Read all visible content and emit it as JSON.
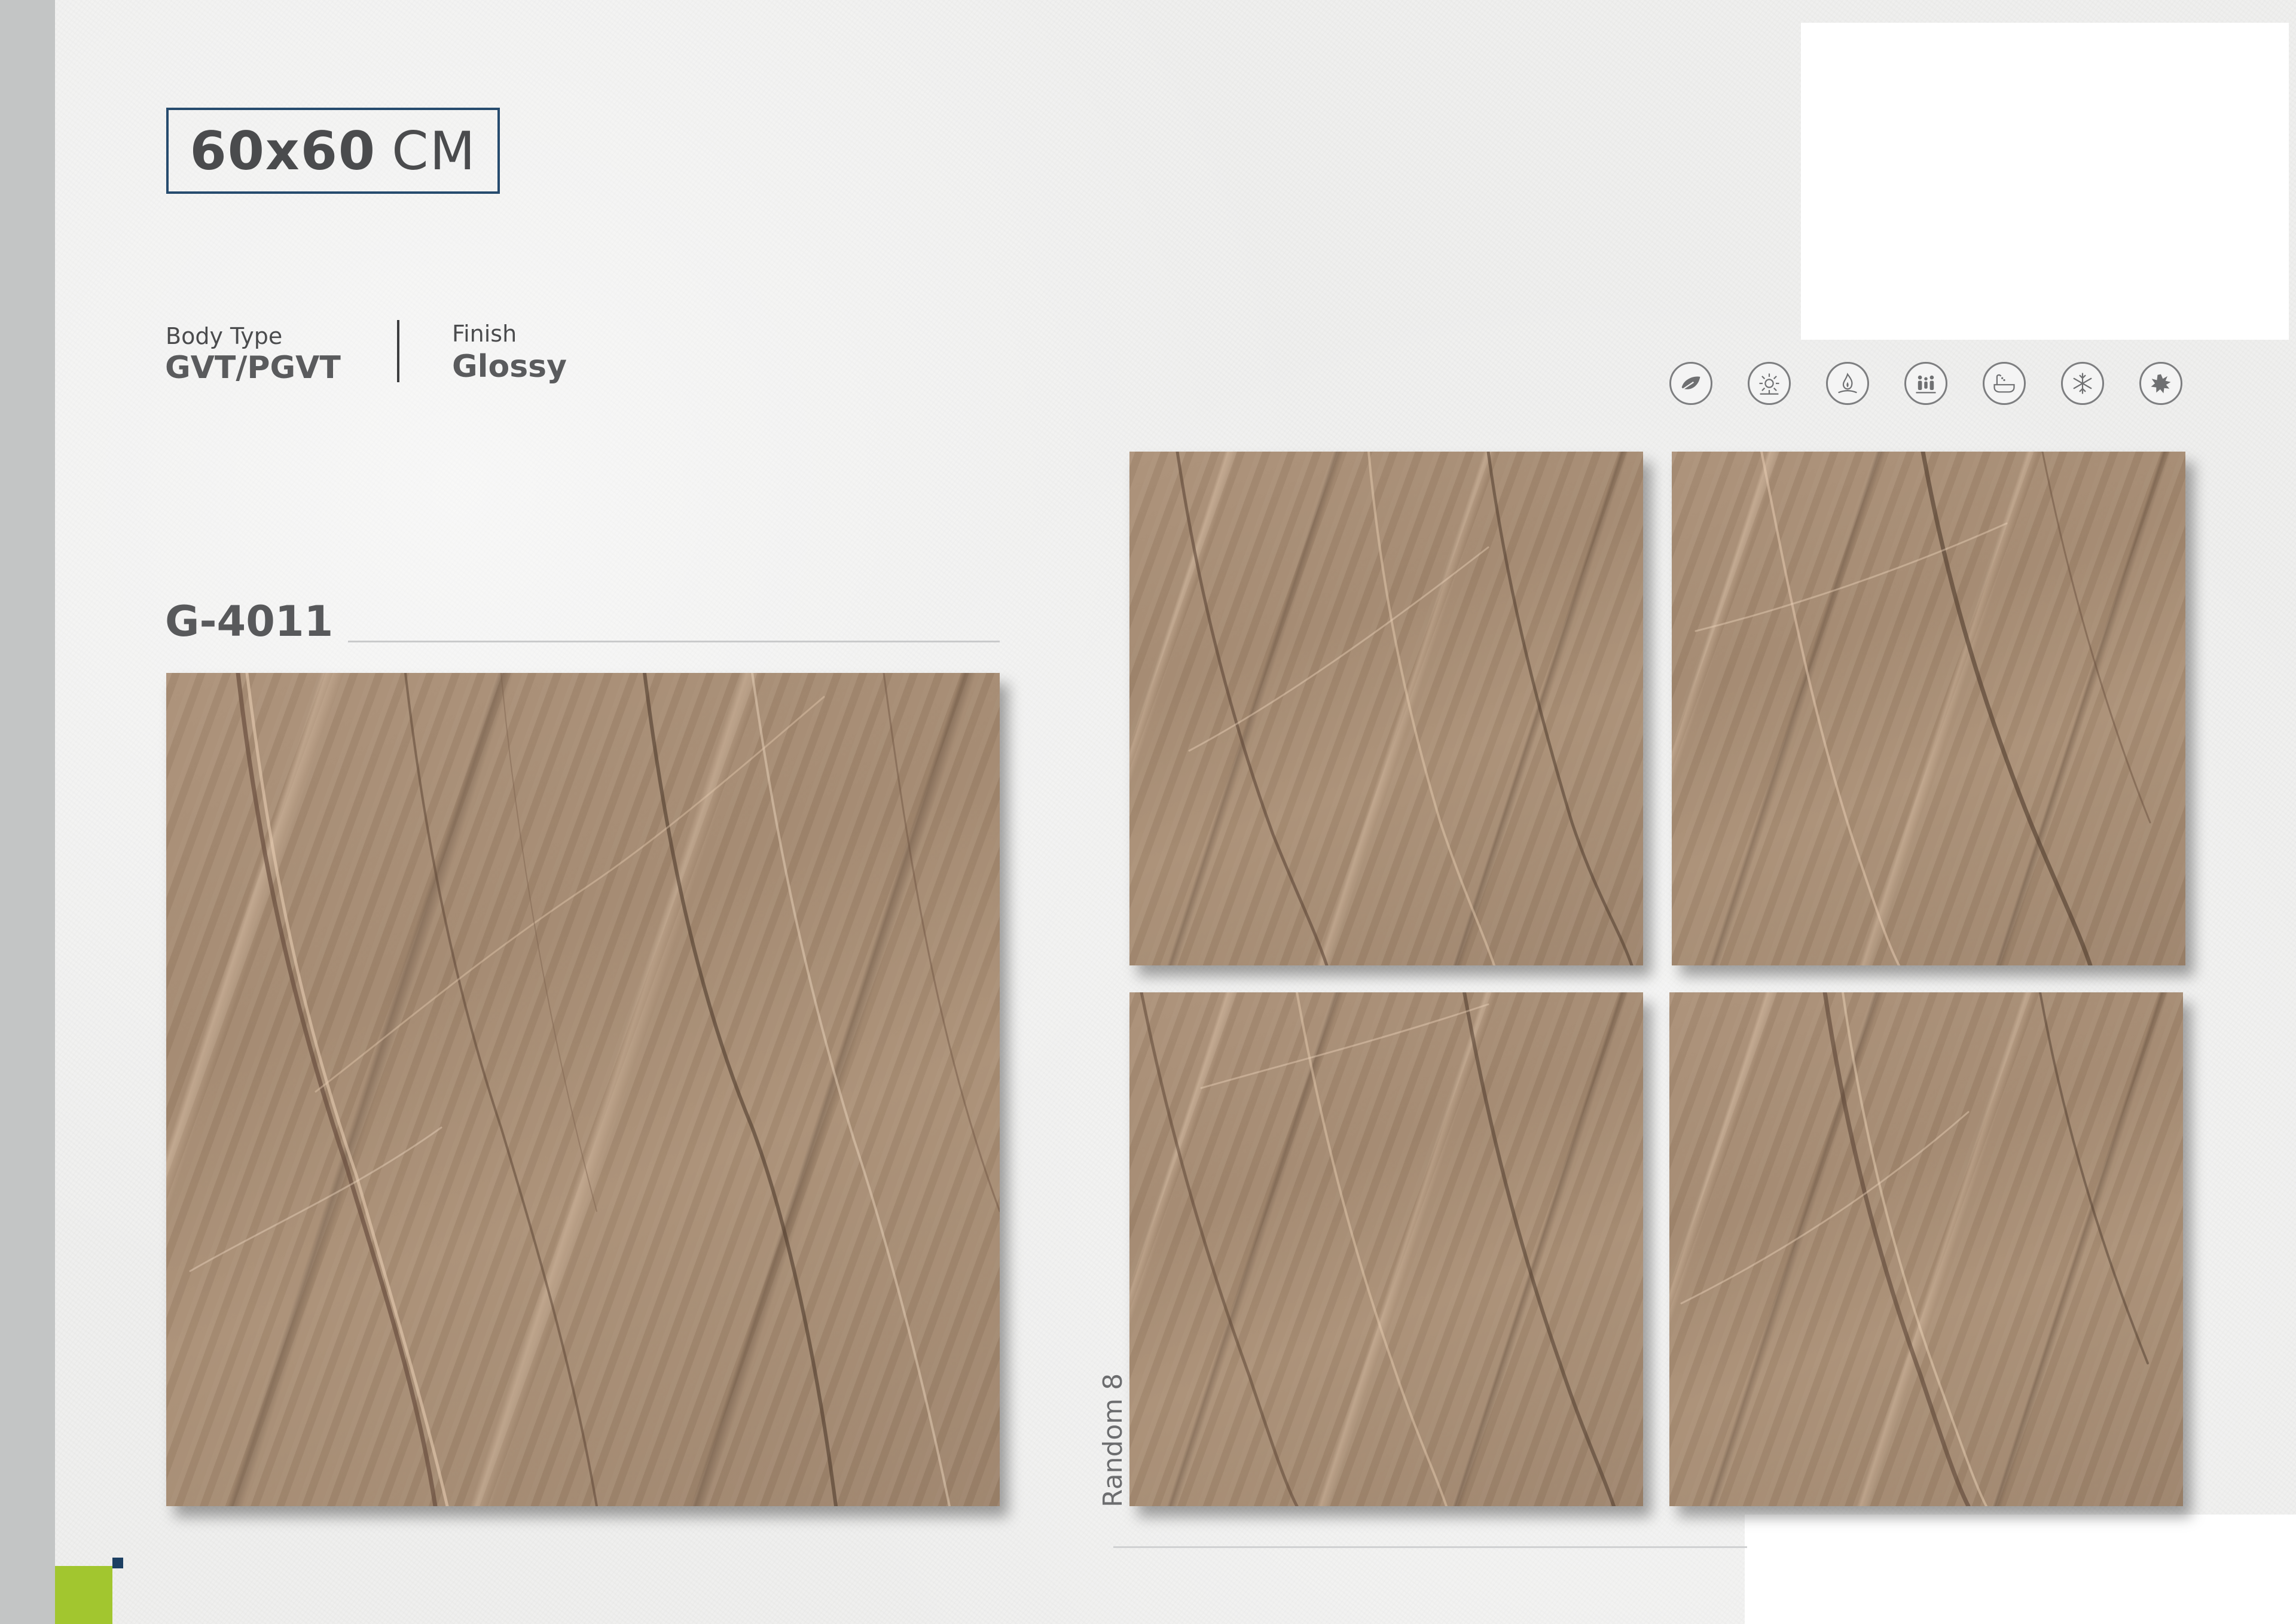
{
  "size": {
    "number": "60x60",
    "unit": "CM"
  },
  "specs": {
    "body_type_label": "Body Type",
    "body_type_value": "GVT/PGVT",
    "finish_label": "Finish",
    "finish_value": "Glossy"
  },
  "product_code": "G-4011",
  "random_label": "Random 8",
  "feature_icons": [
    "leaf-icon",
    "sun-icon",
    "fire-resistant-icon",
    "family-icon",
    "bathtub-icon",
    "snowflake-icon",
    "stain-resistant-icon"
  ],
  "colors": {
    "side_bar": "#c3c5c5",
    "accent_green": "#a2c62f",
    "accent_navy": "#1c3f62",
    "size_border": "#264b6e",
    "tile_base": "#a58a71"
  }
}
